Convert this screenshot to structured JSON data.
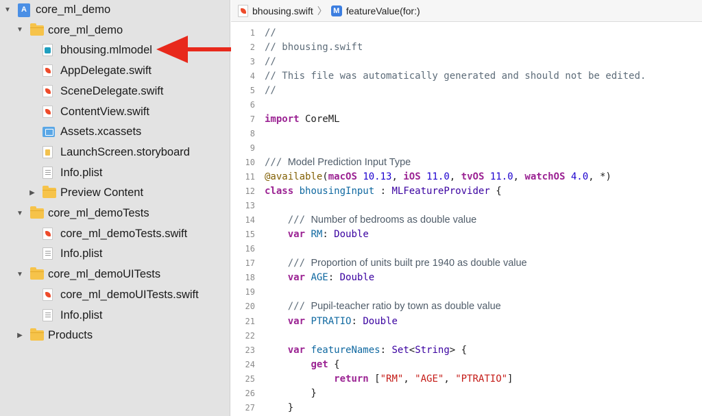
{
  "navigator": {
    "items": [
      {
        "label": "core_ml_demo",
        "icon": "project-icon",
        "disclosure": "expanded",
        "indent": 0
      },
      {
        "label": "core_ml_demo",
        "icon": "folder-icon",
        "disclosure": "expanded",
        "indent": 1
      },
      {
        "label": "bhousing.mlmodel",
        "icon": "mlmodel-icon",
        "disclosure": "none",
        "indent": 2
      },
      {
        "label": "AppDelegate.swift",
        "icon": "swift-file-icon",
        "disclosure": "none",
        "indent": 2
      },
      {
        "label": "SceneDelegate.swift",
        "icon": "swift-file-icon",
        "disclosure": "none",
        "indent": 2
      },
      {
        "label": "ContentView.swift",
        "icon": "swift-file-icon",
        "disclosure": "none",
        "indent": 2
      },
      {
        "label": "Assets.xcassets",
        "icon": "assets-icon",
        "disclosure": "none",
        "indent": 2
      },
      {
        "label": "LaunchScreen.storyboard",
        "icon": "storyboard-icon",
        "disclosure": "none",
        "indent": 2
      },
      {
        "label": "Info.plist",
        "icon": "plist-icon",
        "disclosure": "none",
        "indent": 2
      },
      {
        "label": "Preview Content",
        "icon": "folder-icon",
        "disclosure": "collapsed",
        "indent": 2
      },
      {
        "label": "core_ml_demoTests",
        "icon": "folder-icon",
        "disclosure": "expanded",
        "indent": 1
      },
      {
        "label": "core_ml_demoTests.swift",
        "icon": "swift-file-icon",
        "disclosure": "none",
        "indent": 2
      },
      {
        "label": "Info.plist",
        "icon": "plist-icon",
        "disclosure": "none",
        "indent": 2
      },
      {
        "label": "core_ml_demoUITests",
        "icon": "folder-icon",
        "disclosure": "expanded",
        "indent": 1
      },
      {
        "label": "core_ml_demoUITests.swift",
        "icon": "swift-file-icon",
        "disclosure": "none",
        "indent": 2
      },
      {
        "label": "Info.plist",
        "icon": "plist-icon",
        "disclosure": "none",
        "indent": 2
      },
      {
        "label": "Products",
        "icon": "folder-icon",
        "disclosure": "collapsed",
        "indent": 1
      }
    ]
  },
  "annotation": {
    "arrow_color": "#e8291c"
  },
  "jumpbar": {
    "file": "bhousing.swift",
    "symbol": "featureValue(for:)",
    "symbol_badge": "M"
  },
  "editor": {
    "lines": [
      {
        "n": "1",
        "tokens": [
          [
            "c",
            "//"
          ]
        ]
      },
      {
        "n": "2",
        "tokens": [
          [
            "c",
            "// bhousing.swift"
          ]
        ]
      },
      {
        "n": "3",
        "tokens": [
          [
            "c",
            "//"
          ]
        ]
      },
      {
        "n": "4",
        "tokens": [
          [
            "c",
            "// This file was automatically generated and should not be edited."
          ]
        ]
      },
      {
        "n": "5",
        "tokens": [
          [
            "c",
            "//"
          ]
        ]
      },
      {
        "n": "6",
        "tokens": []
      },
      {
        "n": "7",
        "tokens": [
          [
            "kw",
            "import"
          ],
          [
            "",
            " CoreML"
          ]
        ]
      },
      {
        "n": "8",
        "tokens": []
      },
      {
        "n": "9",
        "tokens": []
      },
      {
        "n": "10",
        "tokens": [
          [
            "c",
            "/// "
          ],
          [
            "doc",
            "Model Prediction Input Type"
          ]
        ]
      },
      {
        "n": "11",
        "tokens": [
          [
            "attr",
            "@available"
          ],
          [
            "",
            "("
          ],
          [
            "kw",
            "macOS"
          ],
          [
            "",
            " "
          ],
          [
            "num",
            "10.13"
          ],
          [
            "",
            ", "
          ],
          [
            "kw",
            "iOS"
          ],
          [
            "",
            " "
          ],
          [
            "num",
            "11.0"
          ],
          [
            "",
            ", "
          ],
          [
            "kw",
            "tvOS"
          ],
          [
            "",
            " "
          ],
          [
            "num",
            "11.0"
          ],
          [
            "",
            ", "
          ],
          [
            "kw",
            "watchOS"
          ],
          [
            "",
            " "
          ],
          [
            "num",
            "4.0"
          ],
          [
            "",
            ", *)"
          ]
        ]
      },
      {
        "n": "12",
        "tokens": [
          [
            "kw",
            "class"
          ],
          [
            "",
            " "
          ],
          [
            "prop",
            "bhousingInput"
          ],
          [
            "",
            " : "
          ],
          [
            "tp",
            "MLFeatureProvider"
          ],
          [
            "",
            " {"
          ]
        ]
      },
      {
        "n": "13",
        "tokens": []
      },
      {
        "n": "14",
        "tokens": [
          [
            "",
            "    "
          ],
          [
            "c",
            "/// "
          ],
          [
            "doc",
            "Number of bedrooms as double value"
          ]
        ]
      },
      {
        "n": "15",
        "tokens": [
          [
            "",
            "    "
          ],
          [
            "kw",
            "var"
          ],
          [
            "",
            " "
          ],
          [
            "prop",
            "RM"
          ],
          [
            "",
            ": "
          ],
          [
            "tp",
            "Double"
          ]
        ]
      },
      {
        "n": "16",
        "tokens": []
      },
      {
        "n": "17",
        "tokens": [
          [
            "",
            "    "
          ],
          [
            "c",
            "/// "
          ],
          [
            "doc",
            "Proportion of units built pre 1940 as double value"
          ]
        ]
      },
      {
        "n": "18",
        "tokens": [
          [
            "",
            "    "
          ],
          [
            "kw",
            "var"
          ],
          [
            "",
            " "
          ],
          [
            "prop",
            "AGE"
          ],
          [
            "",
            ": "
          ],
          [
            "tp",
            "Double"
          ]
        ]
      },
      {
        "n": "19",
        "tokens": []
      },
      {
        "n": "20",
        "tokens": [
          [
            "",
            "    "
          ],
          [
            "c",
            "/// "
          ],
          [
            "doc",
            "Pupil-teacher ratio by town as double value"
          ]
        ]
      },
      {
        "n": "21",
        "tokens": [
          [
            "",
            "    "
          ],
          [
            "kw",
            "var"
          ],
          [
            "",
            " "
          ],
          [
            "prop",
            "PTRATIO"
          ],
          [
            "",
            ": "
          ],
          [
            "tp",
            "Double"
          ]
        ]
      },
      {
        "n": "22",
        "tokens": []
      },
      {
        "n": "23",
        "tokens": [
          [
            "",
            "    "
          ],
          [
            "kw",
            "var"
          ],
          [
            "",
            " "
          ],
          [
            "prop",
            "featureNames"
          ],
          [
            "",
            ": "
          ],
          [
            "tp",
            "Set"
          ],
          [
            "",
            "<"
          ],
          [
            "tp",
            "String"
          ],
          [
            "",
            "> {"
          ]
        ]
      },
      {
        "n": "24",
        "tokens": [
          [
            "",
            "        "
          ],
          [
            "kw",
            "get"
          ],
          [
            "",
            " {"
          ]
        ]
      },
      {
        "n": "25",
        "tokens": [
          [
            "",
            "            "
          ],
          [
            "kw",
            "return"
          ],
          [
            "",
            " ["
          ],
          [
            "str",
            "\"RM\""
          ],
          [
            "",
            ", "
          ],
          [
            "str",
            "\"AGE\""
          ],
          [
            "",
            ", "
          ],
          [
            "str",
            "\"PTRATIO\""
          ],
          [
            "",
            "]"
          ]
        ]
      },
      {
        "n": "26",
        "tokens": [
          [
            "",
            "        }"
          ]
        ]
      },
      {
        "n": "27",
        "tokens": [
          [
            "",
            "    }"
          ]
        ]
      }
    ]
  }
}
